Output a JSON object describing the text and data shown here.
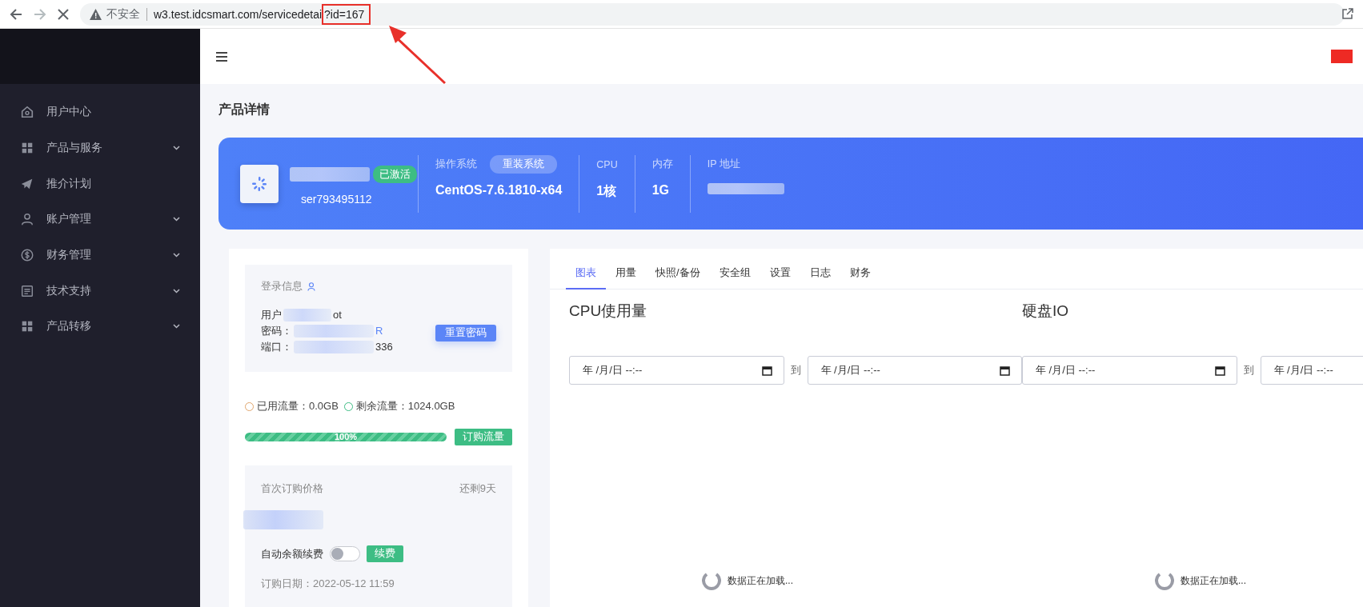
{
  "browser": {
    "security": "不安全",
    "url": "w3.test.idcsmart.com/servicedetai",
    "url_query": "?id=167"
  },
  "sidebar": {
    "items": [
      {
        "label": "用户中心",
        "expandable": false
      },
      {
        "label": "产品与服务",
        "expandable": true
      },
      {
        "label": "推介计划",
        "expandable": false
      },
      {
        "label": "账户管理",
        "expandable": true
      },
      {
        "label": "财务管理",
        "expandable": true
      },
      {
        "label": "技术支持",
        "expandable": true
      },
      {
        "label": "产品转移",
        "expandable": true
      }
    ]
  },
  "page_title": "产品详情",
  "product": {
    "name": "ser793495112",
    "status": "已激活",
    "os_label": "操作系统",
    "reinstall_button": "重装系统",
    "os": "CentOS-7.6.1810-x64",
    "specs": [
      {
        "label": "CPU",
        "value": "1核"
      },
      {
        "label": "内存",
        "value": "1G"
      }
    ],
    "ip_label": "IP 地址"
  },
  "login": {
    "title": "登录信息",
    "lines": [
      {
        "label": "用户",
        "tail": "ot"
      },
      {
        "label": "密码：",
        "tail": "R"
      },
      {
        "label": "端口：",
        "tail": "336"
      }
    ],
    "reset_button": "重置密码"
  },
  "traffic": {
    "used": "已用流量：0.0GB",
    "remaining": "剩余流量：1024.0GB",
    "level": 1,
    "percent": "100%",
    "buy_button": "订购流量"
  },
  "billing": {
    "title": "首次订购价格",
    "remaining_days": "还剩9天",
    "auto_renew": {
      "label": "自动余额续费",
      "on": false
    },
    "renew_button": "续费",
    "order_date": "订购日期：2022-05-12 11:59"
  },
  "tabs": [
    {
      "label": "图表",
      "selected": true
    },
    {
      "label": "用量",
      "selected": false
    },
    {
      "label": "快照/备份",
      "selected": false
    },
    {
      "label": "安全组",
      "selected": false
    },
    {
      "label": "设置",
      "selected": false
    },
    {
      "label": "日志",
      "selected": false
    },
    {
      "label": "财务",
      "selected": false
    }
  ],
  "charts": [
    {
      "title": "CPU使用量",
      "from_placeholder": "年 /月/日 --:--",
      "separator": "到",
      "to_placeholder": "年 /月/日 --:--",
      "loading": "数据正在加载..."
    },
    {
      "title": "硬盘IO",
      "from_placeholder": "年 /月/日 --:--",
      "separator": "到",
      "to_placeholder": "年 /月/日 --:--",
      "loading": "数据正在加载..."
    }
  ]
}
